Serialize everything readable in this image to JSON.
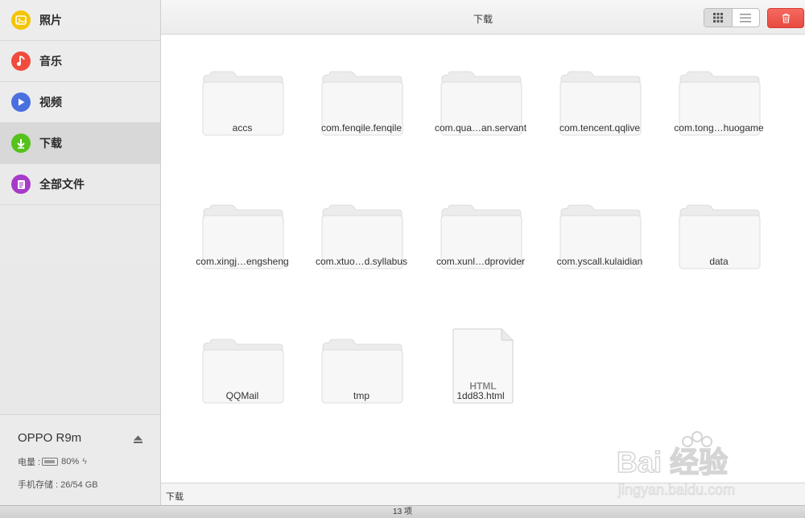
{
  "sidebar": {
    "items": [
      {
        "label": "照片",
        "icon": "photo-icon",
        "color": "#f5c400"
      },
      {
        "label": "音乐",
        "icon": "music-note-icon",
        "color": "#f04b3d"
      },
      {
        "label": "视频",
        "icon": "play-icon",
        "color": "#4a6fe0"
      },
      {
        "label": "下载",
        "icon": "download-arrow-icon",
        "color": "#55c21b",
        "active": true
      },
      {
        "label": "全部文件",
        "icon": "document-icon",
        "color": "#a63bc9"
      }
    ],
    "device": {
      "name": "OPPO R9m",
      "battery_label": "电量 :",
      "battery_percent": "80%",
      "storage_label": "手机存储 : 26/54 GB"
    }
  },
  "toolbar": {
    "title": "下载",
    "grid_view_icon": "grid-view-icon",
    "list_view_icon": "list-view-icon",
    "delete_icon": "trash-icon",
    "delete_color": "#e74a40"
  },
  "files": [
    {
      "name": "accs",
      "type": "folder"
    },
    {
      "name": "com.fenqile.fenqile",
      "type": "folder"
    },
    {
      "name": "com.qua…an.servant",
      "type": "folder"
    },
    {
      "name": "com.tencent.qqlive",
      "type": "folder"
    },
    {
      "name": "com.tong…huogame",
      "type": "folder"
    },
    {
      "name": "com.xingj…engsheng",
      "type": "folder"
    },
    {
      "name": "com.xtuo…d.syllabus",
      "type": "folder"
    },
    {
      "name": "com.xunl…dprovider",
      "type": "folder"
    },
    {
      "name": "com.yscall.kulaidian",
      "type": "folder"
    },
    {
      "name": "data",
      "type": "folder"
    },
    {
      "name": "QQMail",
      "type": "folder"
    },
    {
      "name": "tmp",
      "type": "folder"
    },
    {
      "name": "1dd83.html",
      "type": "file",
      "badge": "HTML"
    }
  ],
  "pathbar": {
    "path": "下载"
  },
  "status": {
    "count": "13 项"
  },
  "watermark": {
    "text": "Bai 经验",
    "url_text": "jingyan.baidu.com"
  }
}
